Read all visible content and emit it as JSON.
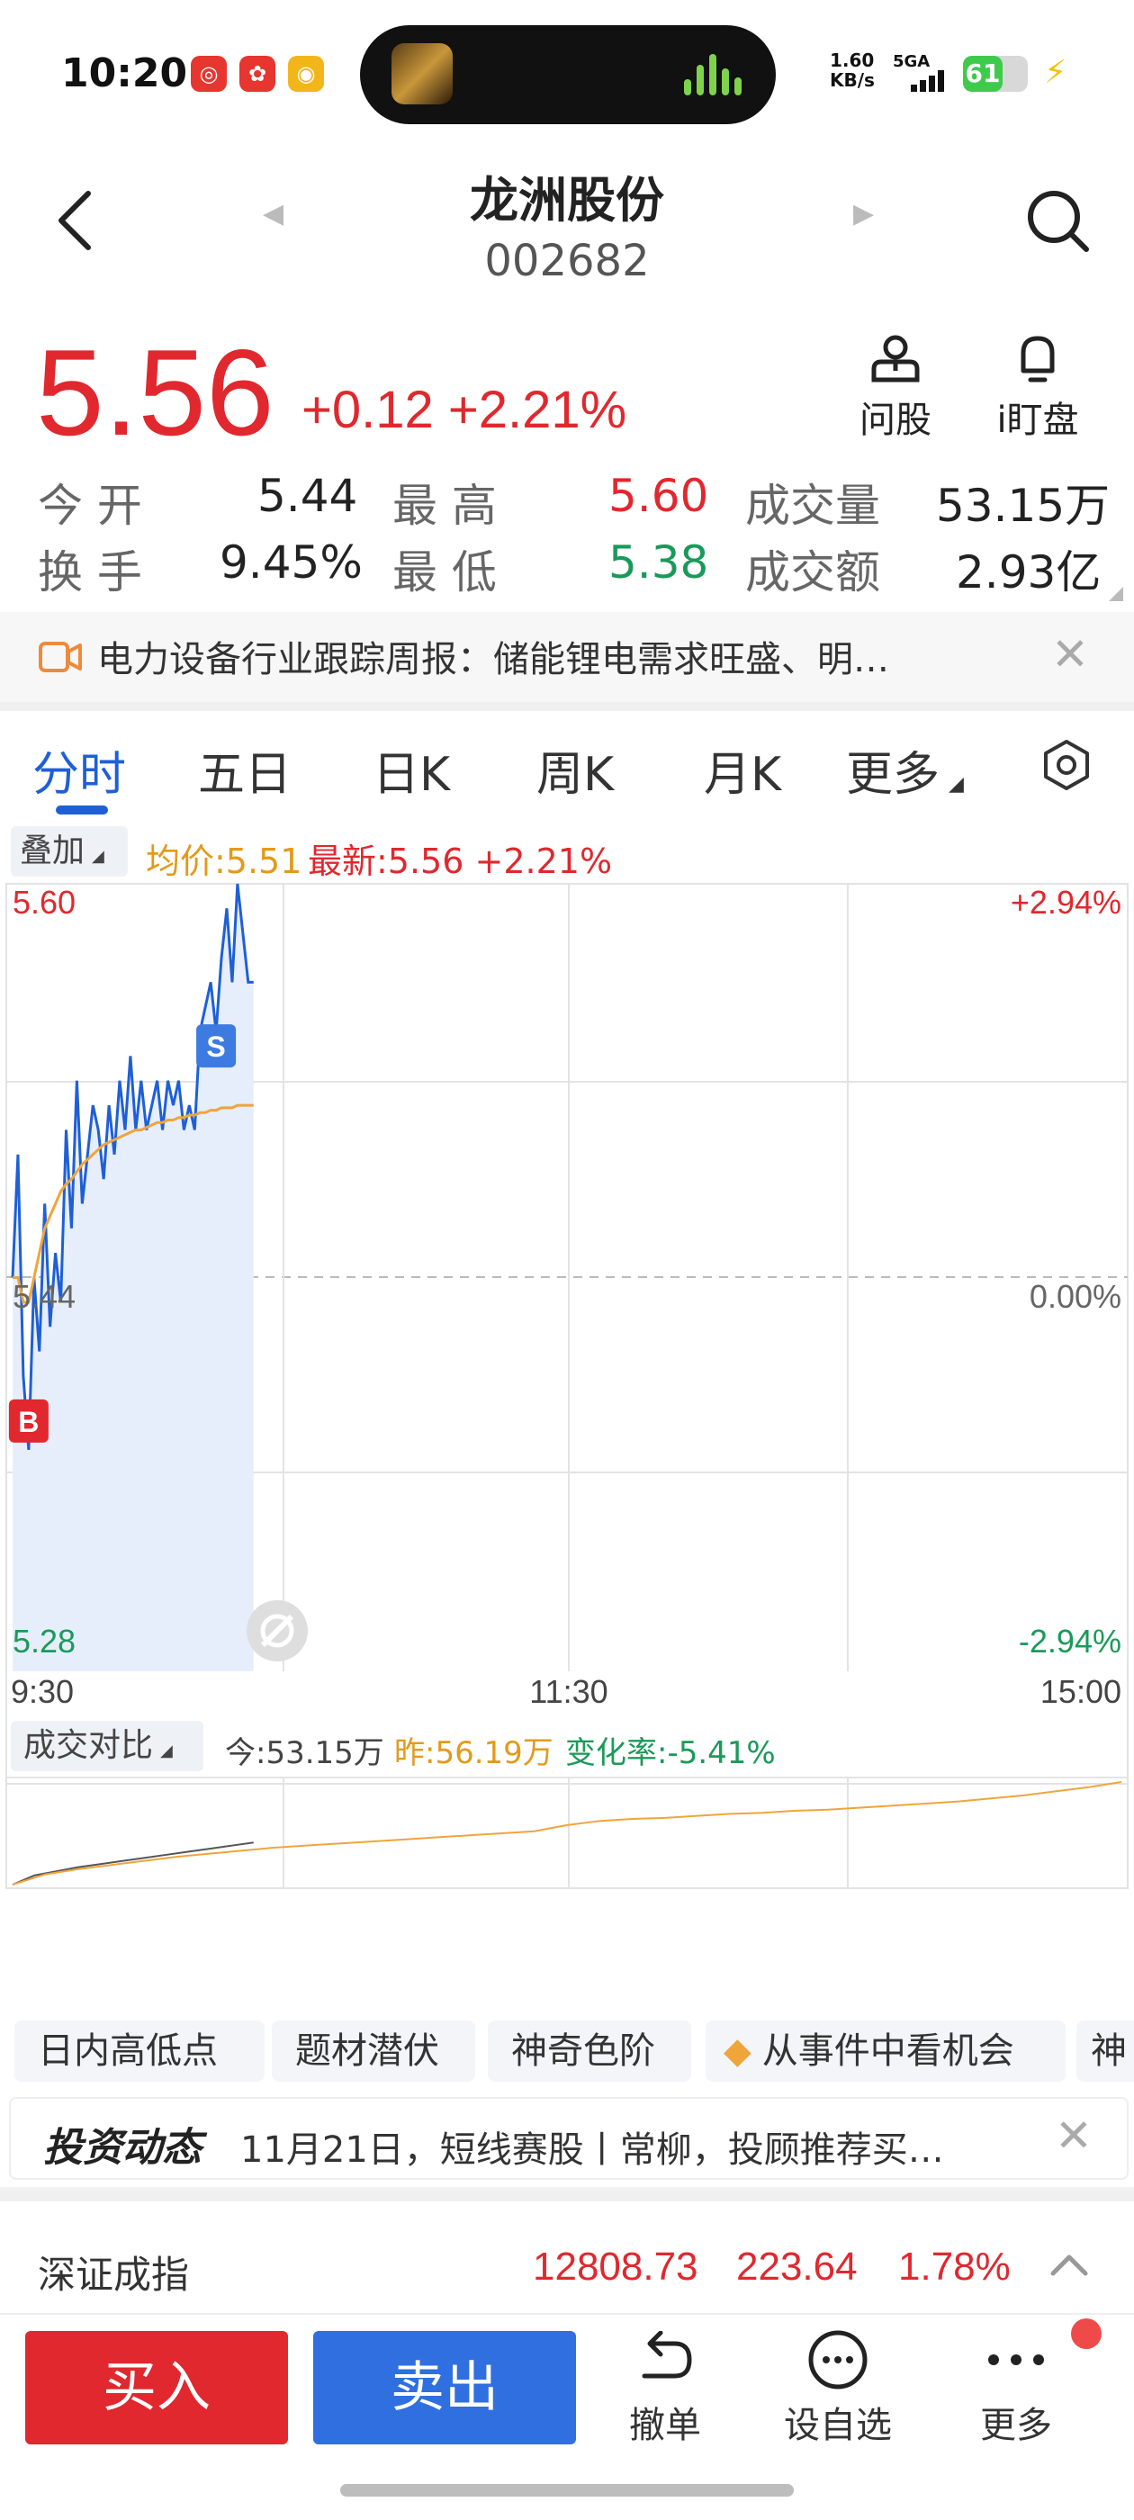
{
  "status_bar": {
    "time": "10:20",
    "net_speed_value": "1.60",
    "net_speed_unit": "KB/s",
    "network": "5GA",
    "battery": "61",
    "app_icons": [
      "netease-music-icon",
      "taobao-icon",
      "weibo-icon"
    ]
  },
  "header": {
    "title": "龙洲股份",
    "code": "002682"
  },
  "quote": {
    "price": "5.56",
    "change": "+0.12",
    "change_pct": "+2.21%",
    "ask_label": "问股",
    "watch_label": "i盯盘"
  },
  "stats": {
    "open_label": "今  开",
    "open_value": "5.44",
    "high_label": "最  高",
    "high_value": "5.60",
    "volume_label": "成交量",
    "volume_value": "53.15万",
    "turnover_label": "换  手",
    "turnover_value": "9.45%",
    "low_label": "最  低",
    "low_value": "5.38",
    "amount_label": "成交额",
    "amount_value": "2.93亿"
  },
  "news_banner": {
    "text": "电力设备行业跟踪周报：储能锂电需求旺盛、明…"
  },
  "tabs": {
    "items": [
      "分时",
      "五日",
      "日K",
      "周K",
      "月K",
      "更多"
    ]
  },
  "chart_legend": {
    "overlay": "叠加",
    "avg_price": "均价:5.51",
    "latest": "最新:5.56 +2.21%"
  },
  "chart_data": [
    {
      "type": "line",
      "y_left_ticks": [
        "5.60",
        "5.44",
        "5.28"
      ],
      "y_right_ticks": [
        "+2.94%",
        "0.00%",
        "-2.94%"
      ],
      "x_ticks": [
        "9:30",
        "11:30",
        "15:00"
      ],
      "ylim": [
        5.28,
        5.6
      ],
      "reference_price": 5.44,
      "series": [
        {
          "name": "最新",
          "color": "#1f5fd6",
          "values": [
            5.44,
            5.49,
            5.4,
            5.37,
            5.44,
            5.41,
            5.47,
            5.42,
            5.45,
            5.43,
            5.5,
            5.46,
            5.52,
            5.47,
            5.49,
            5.51,
            5.5,
            5.48,
            5.51,
            5.49,
            5.52,
            5.5,
            5.53,
            5.5,
            5.52,
            5.5,
            5.51,
            5.52,
            5.5,
            5.52,
            5.51,
            5.52,
            5.5,
            5.51,
            5.5,
            5.54,
            5.55,
            5.56,
            5.54,
            5.57,
            5.59,
            5.56,
            5.6,
            5.58,
            5.56,
            5.56
          ]
        },
        {
          "name": "均价",
          "color": "#f0a53a",
          "values": [
            5.44,
            5.44,
            5.43,
            5.43,
            5.44,
            5.45,
            5.46,
            5.465,
            5.47,
            5.475,
            5.478,
            5.48,
            5.483,
            5.486,
            5.488,
            5.49,
            5.492,
            5.494,
            5.495,
            5.496,
            5.497,
            5.498,
            5.499,
            5.5,
            5.5,
            5.501,
            5.502,
            5.503,
            5.503,
            5.504,
            5.504,
            5.505,
            5.505,
            5.506,
            5.506,
            5.507,
            5.507,
            5.508,
            5.508,
            5.509,
            5.509,
            5.509,
            5.51,
            5.51,
            5.51,
            5.51
          ]
        }
      ],
      "markers": [
        {
          "label": "S",
          "index": 38,
          "color": "#3d7be0"
        },
        {
          "label": "B",
          "index": 3,
          "color": "#e0282e"
        }
      ]
    },
    {
      "type": "line",
      "title": "成交对比",
      "series": [
        {
          "name": "今",
          "color": "#555555",
          "values": [
            0,
            0.09,
            0.13,
            0.17,
            0.2,
            0.23,
            0.26,
            0.29,
            0.32,
            0.35,
            0.38,
            0.41
          ]
        },
        {
          "name": "昨",
          "color": "#f0a53a",
          "values": [
            0,
            0.1,
            0.15,
            0.19,
            0.23,
            0.27,
            0.3,
            0.33,
            0.36,
            0.38,
            0.4,
            0.42,
            0.44,
            0.46,
            0.48,
            0.5,
            0.52,
            0.58,
            0.62,
            0.64,
            0.65,
            0.67,
            0.69,
            0.7,
            0.72,
            0.73,
            0.75,
            0.77,
            0.79,
            0.81,
            0.84,
            0.87,
            0.91,
            0.95,
            1.0
          ]
        }
      ]
    }
  ],
  "compare": {
    "title": "成交对比",
    "today": "今:53.15万",
    "yesterday": "昨:56.19万",
    "rate": "变化率:-5.41%"
  },
  "chips": [
    "日内高低点",
    "题材潜伏",
    "神奇色阶",
    "从事件中看机会",
    "神"
  ],
  "invest": {
    "logo": "投资动态",
    "text": "11月21日，短线赛股丨常柳，投顾推荐买…"
  },
  "index": {
    "name": "深证成指",
    "value": "12808.73",
    "change": "223.64",
    "pct": "1.78%"
  },
  "bottom_bar": {
    "buy": "买入",
    "sell": "卖出",
    "cancel": "撤单",
    "watchlist": "设自选",
    "more": "更多"
  }
}
